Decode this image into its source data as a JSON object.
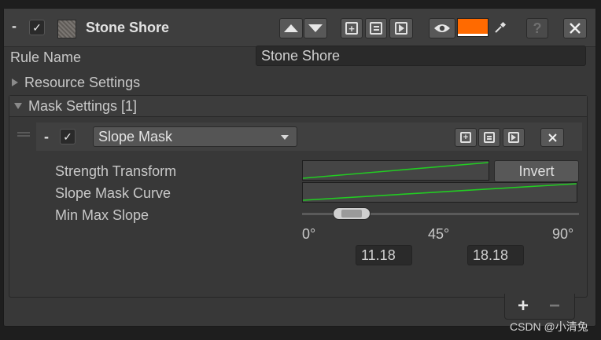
{
  "header": {
    "collapse_label": "-",
    "title": "Stone Shore",
    "color_swatch": "#ff6a00"
  },
  "rule_name": {
    "label": "Rule Name",
    "value": "Stone Shore"
  },
  "resource_settings": {
    "label": "Resource Settings"
  },
  "mask_settings": {
    "label": "Mask Settings [1]"
  },
  "slope_mask": {
    "collapse_label": "-",
    "dropdown_value": "Slope Mask",
    "strength_label": "Strength Transform",
    "curve_label": "Slope Mask Curve",
    "minmax_label": "Min Max Slope",
    "invert_label": "Invert",
    "scale_min": "0°",
    "scale_mid": "45°",
    "scale_max": "90°",
    "min_value": "11.18",
    "max_value": "18.18",
    "curve_color": "#22cc22"
  },
  "footer": {
    "add_label": "+",
    "remove_label": "−"
  },
  "watermark": "CSDN @小清兔"
}
